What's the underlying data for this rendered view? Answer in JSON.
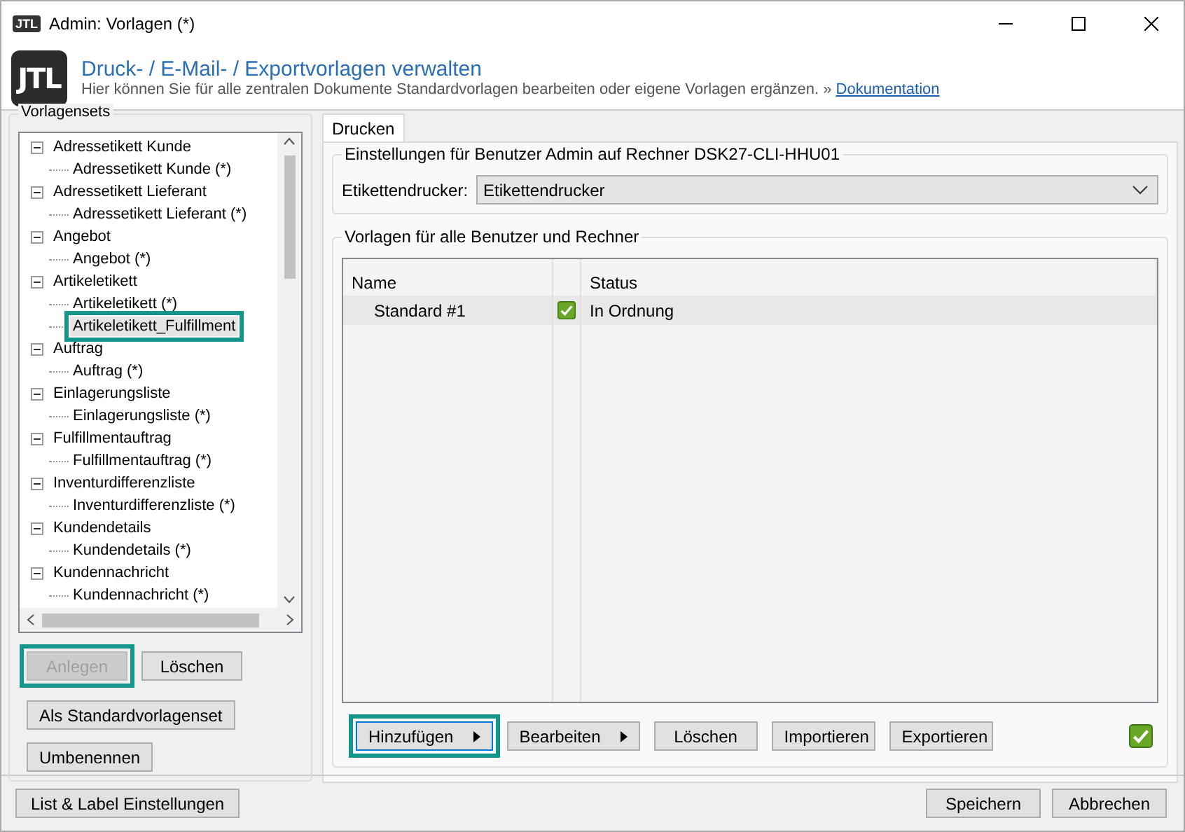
{
  "window": {
    "title": "Admin: Vorlagen (*)",
    "logo": "JTL"
  },
  "header": {
    "logo": "JTL",
    "title": "Druck- / E-Mail- / Exportvorlagen verwalten",
    "subtitle": "Hier können Sie für alle zentralen Dokumente Standardvorlagen bearbeiten oder eigene Vorlagen ergänzen. »",
    "link": "Dokumentation"
  },
  "vorlagensets": {
    "title": "Vorlagensets",
    "tree": [
      {
        "label": "Adressetikett Kunde",
        "expanded": true,
        "children": [
          {
            "label": "Adressetikett Kunde (*)",
            "selected": false,
            "highlighted": false
          }
        ]
      },
      {
        "label": "Adressetikett Lieferant",
        "expanded": true,
        "children": [
          {
            "label": "Adressetikett Lieferant (*)",
            "selected": false,
            "highlighted": false
          }
        ]
      },
      {
        "label": "Angebot",
        "expanded": true,
        "children": [
          {
            "label": "Angebot (*)",
            "selected": false,
            "highlighted": false
          }
        ]
      },
      {
        "label": "Artikeletikett",
        "expanded": true,
        "children": [
          {
            "label": "Artikeletikett (*)",
            "selected": false,
            "highlighted": false
          },
          {
            "label": "Artikeletikett_Fulfillment",
            "selected": true,
            "highlighted": true
          }
        ]
      },
      {
        "label": "Auftrag",
        "expanded": true,
        "children": [
          {
            "label": "Auftrag (*)",
            "selected": false,
            "highlighted": false
          }
        ]
      },
      {
        "label": "Einlagerungsliste",
        "expanded": true,
        "children": [
          {
            "label": "Einlagerungsliste (*)",
            "selected": false,
            "highlighted": false
          }
        ]
      },
      {
        "label": "Fulfillmentauftrag",
        "expanded": true,
        "children": [
          {
            "label": "Fulfillmentauftrag (*)",
            "selected": false,
            "highlighted": false
          }
        ]
      },
      {
        "label": "Inventurdifferenzliste",
        "expanded": true,
        "children": [
          {
            "label": "Inventurdifferenzliste (*)",
            "selected": false,
            "highlighted": false
          }
        ]
      },
      {
        "label": "Kundendetails",
        "expanded": true,
        "children": [
          {
            "label": "Kundendetails (*)",
            "selected": false,
            "highlighted": false
          }
        ]
      },
      {
        "label": "Kundennachricht",
        "expanded": true,
        "children": [
          {
            "label": "Kundennachricht (*)",
            "selected": false,
            "highlighted": false
          }
        ]
      }
    ],
    "buttons": [
      {
        "label": "Anlegen",
        "disabled": true,
        "highlighted": true
      },
      {
        "label": "Löschen",
        "disabled": false,
        "highlighted": false
      }
    ],
    "set_default": "Als Standardvorlagenset",
    "rename": "Umbenennen"
  },
  "tabs": [
    {
      "label": "Drucken",
      "selected": true
    }
  ],
  "user_settings": {
    "title": "Einstellungen für Benutzer Admin auf Rechner DSK27-CLI-HHU01",
    "printer_label": "Etikettendrucker:",
    "printer_value": "Etikettendrucker"
  },
  "templates": {
    "title": "Vorlagen für alle Benutzer und Rechner",
    "columns": [
      "Name",
      "Status"
    ],
    "rows": [
      {
        "name": "Standard #1",
        "ok": true,
        "status": "In Ordnung",
        "selected": true
      }
    ],
    "buttons": [
      {
        "label": "Hinzufügen",
        "kind": "menu",
        "highlighted": true
      },
      {
        "label": "Bearbeiten",
        "kind": "menu",
        "highlighted": false
      },
      {
        "label": "Löschen",
        "kind": "plain",
        "highlighted": false
      },
      {
        "label": "Importieren",
        "kind": "plain",
        "highlighted": false
      },
      {
        "label": "Exportieren",
        "kind": "plain",
        "highlighted": false
      }
    ],
    "status_ok": true
  },
  "footer": {
    "left": "List & Label Einstellungen",
    "buttons": [
      "Speichern",
      "Abbrechen"
    ]
  }
}
